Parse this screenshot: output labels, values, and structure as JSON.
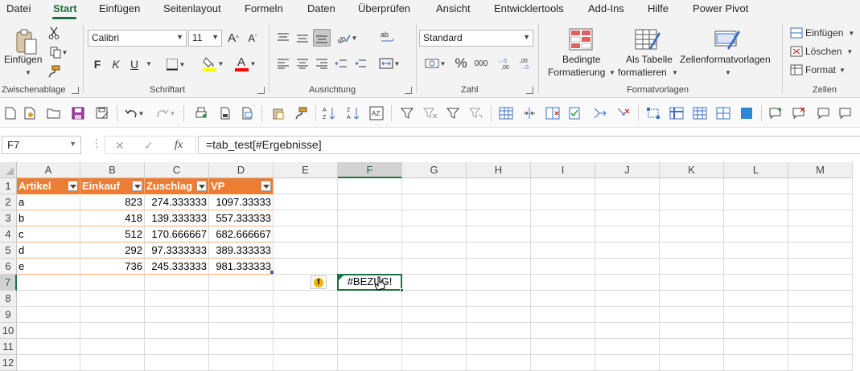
{
  "tabs": [
    "Datei",
    "Start",
    "Einfügen",
    "Seitenlayout",
    "Formeln",
    "Daten",
    "Überprüfen",
    "Ansicht",
    "Entwicklertools",
    "Add-Ins",
    "Hilfe",
    "Power Pivot"
  ],
  "active_tab": "Start",
  "ribbon": {
    "clipboard": {
      "paste_label": "Einfügen",
      "group": "Zwischenablage"
    },
    "font": {
      "name": "Calibri",
      "size": "11",
      "bold": "F",
      "italic": "K",
      "underline": "U",
      "group": "Schriftart",
      "highlight_color": "#ffff00",
      "font_color": "#ff0000"
    },
    "alignment": {
      "group": "Ausrichtung"
    },
    "number": {
      "format": "Standard",
      "group": "Zahl"
    },
    "styles": {
      "cond_fmt_1": "Bedingte",
      "cond_fmt_2": "Formatierung",
      "as_table_1": "Als Tabelle",
      "as_table_2": "formatieren",
      "cell_styles": "Zellenformatvorlagen",
      "group": "Formatvorlagen"
    },
    "cells": {
      "insert": "Einfügen",
      "delete": "Löschen",
      "format": "Format",
      "group": "Zellen"
    }
  },
  "formula_bar": {
    "name_box": "F7",
    "fx": "fx",
    "formula": "=tab_test[#Ergebnisse]"
  },
  "columns": [
    "A",
    "B",
    "C",
    "D",
    "E",
    "F",
    "G",
    "H",
    "I",
    "J",
    "K",
    "L",
    "M"
  ],
  "rows": [
    "1",
    "2",
    "3",
    "4",
    "5",
    "6",
    "7",
    "8",
    "9",
    "10",
    "11",
    "12"
  ],
  "selected_column": "F",
  "selected_row": "7",
  "table": {
    "headers": [
      "Artikel",
      "Einkauf",
      "Zuschlag",
      "VP"
    ],
    "rows": [
      [
        "a",
        "823",
        "274.333333",
        "1097.33333"
      ],
      [
        "b",
        "418",
        "139.333333",
        "557.333333"
      ],
      [
        "c",
        "512",
        "170.666667",
        "682.666667"
      ],
      [
        "d",
        "292",
        "97.3333333",
        "389.333333"
      ],
      [
        "e",
        "736",
        "245.333333",
        "981.333333"
      ]
    ]
  },
  "active_cell_value": "#BEZUG!",
  "colors": {
    "accent": "#1e7145",
    "table_header": "#ed7d31",
    "table_border": "#f4b183"
  }
}
